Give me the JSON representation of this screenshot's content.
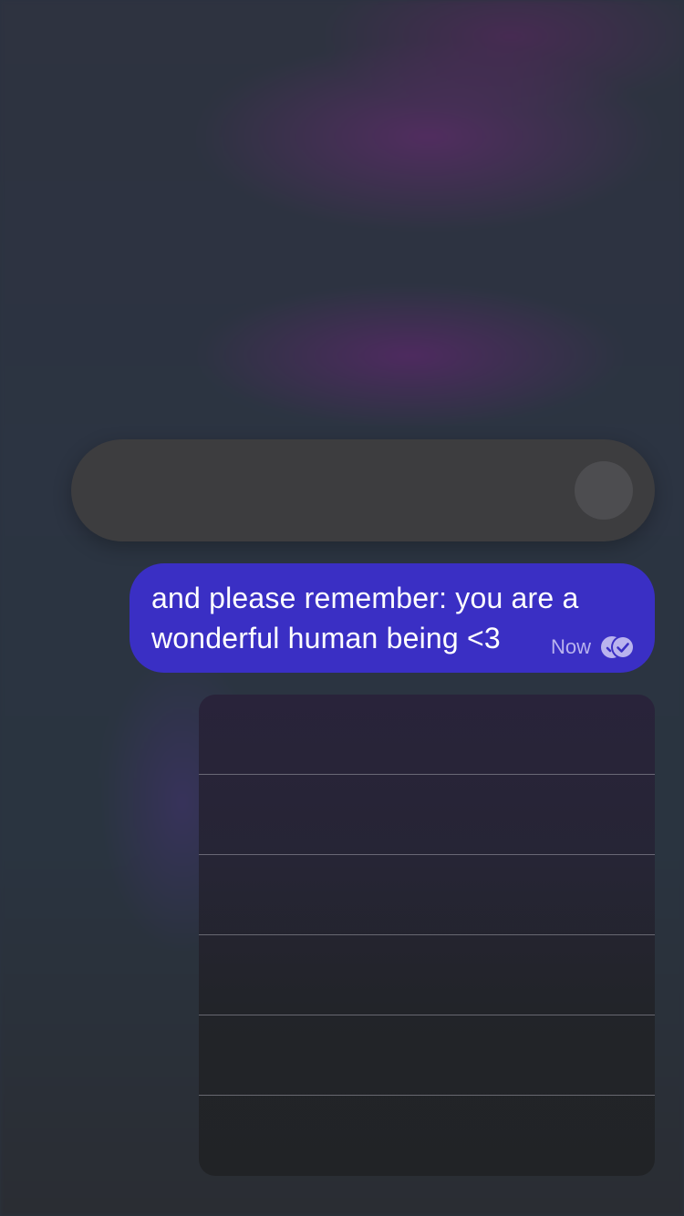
{
  "message": {
    "text": "and please remember: you are a wonderful human being <3",
    "time": "Now",
    "status_icon": "read-receipt-icon",
    "bubble_color": "#3a2fc4"
  },
  "context_menu": {
    "items": [
      {
        "label": ""
      },
      {
        "label": ""
      },
      {
        "label": ""
      },
      {
        "label": ""
      },
      {
        "label": ""
      },
      {
        "label": ""
      }
    ]
  },
  "reaction_bar": {
    "background": "#3d3d3f"
  }
}
